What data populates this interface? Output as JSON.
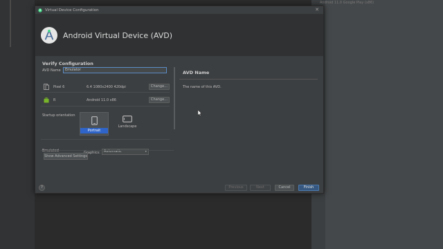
{
  "background": {
    "right_panel_text": "Android 11.0 Google Play (x86)"
  },
  "dialog": {
    "window_title": "Virtual Device Configuration",
    "heading": "Android Virtual Device (AVD)",
    "section_title": "Verify Configuration",
    "avd_name_label": "AVD Name",
    "avd_name_value": "Emulator",
    "device": {
      "name": "Pixel 6",
      "spec": "6.4 1080x2400 420dpi",
      "change_label": "Change..."
    },
    "system_image": {
      "name": "R",
      "spec": "Android 11.0 x86",
      "change_label": "Change..."
    },
    "startup_orientation_label": "Startup orientation",
    "orientations": [
      {
        "label": "Portrait",
        "selected": true
      },
      {
        "label": "Landscape",
        "selected": false
      }
    ],
    "emulated_label": "Emulated",
    "graphics_label": "Graphics:",
    "graphics_value": "Automatic",
    "show_advanced_label": "Show Advanced Settings",
    "info_panel": {
      "title": "AVD Name",
      "description": "The name of this AVD."
    },
    "footer": {
      "help": "?",
      "previous": "Previous",
      "next": "Next",
      "cancel": "Cancel",
      "finish": "Finish"
    }
  },
  "colors": {
    "accent": "#2f65ca",
    "primary_button": "#365880",
    "dialog_bg": "#3c3f41",
    "banner_bg": "#2f3132"
  }
}
